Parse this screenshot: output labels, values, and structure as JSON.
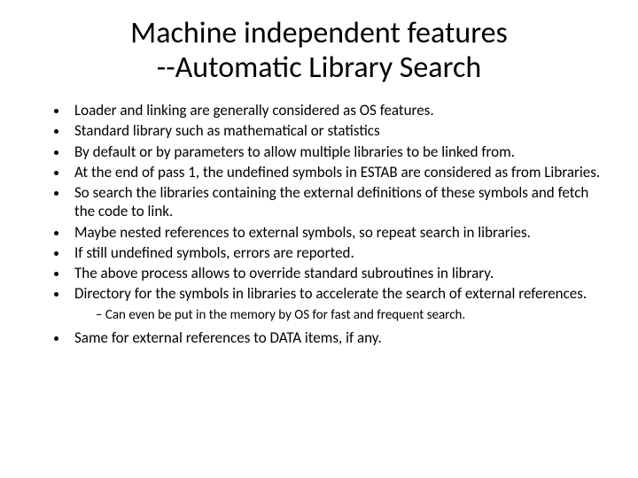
{
  "title_line1": "Machine independent features",
  "title_line2": "--Automatic Library Search",
  "bullets": {
    "b0": "Loader and linking are generally considered as OS features.",
    "b1": "Standard library such as mathematical or statistics",
    "b2": "By default or by parameters to allow multiple libraries to be linked from.",
    "b3": "At the end of pass 1, the undefined symbols in ESTAB are considered as from Libraries.",
    "b4": "So search the libraries containing the external definitions of these symbols and fetch the code to link.",
    "b5": "Maybe nested references to external symbols, so repeat search in libraries.",
    "b6": "If still undefined symbols, errors are reported.",
    "b7": "The above process allows to override standard subroutines in library.",
    "b8": "Directory for the symbols in libraries to accelerate the search of external references.",
    "b8_sub1": "Can even be put in the memory by OS for fast and frequent search.",
    "b9": "Same for external references to DATA items, if any."
  }
}
